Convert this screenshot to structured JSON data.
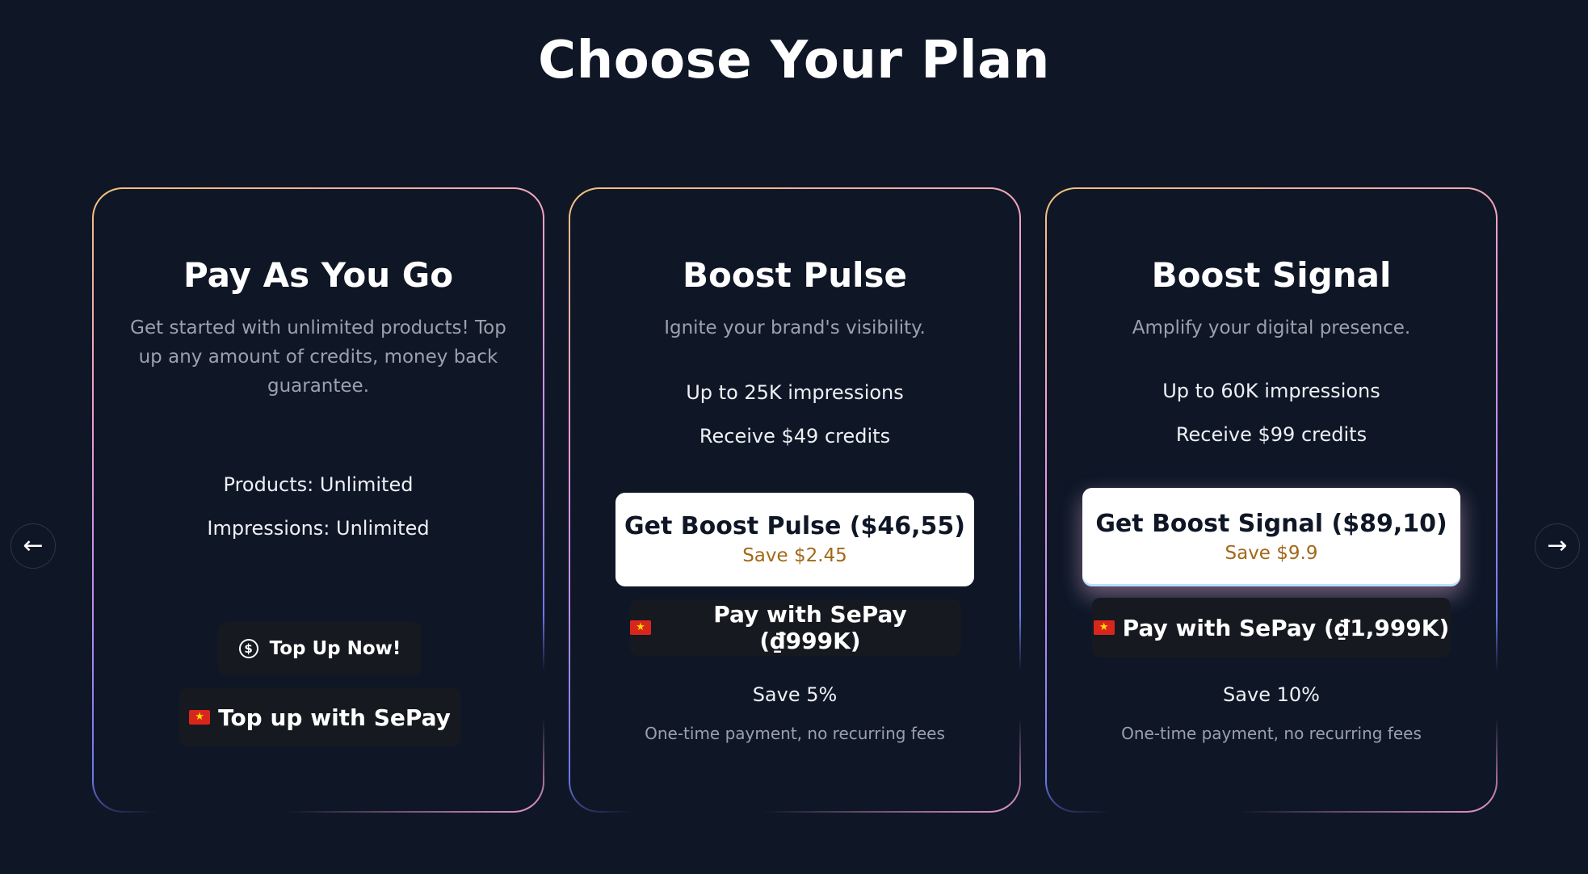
{
  "page": {
    "title": "Choose Your Plan"
  },
  "navigation": {
    "prev_icon": "arrow-left-icon",
    "next_icon": "arrow-right-icon",
    "prev_glyph": "←",
    "next_glyph": "→"
  },
  "plans": [
    {
      "title": "Pay As You Go",
      "description": "Get started with unlimited products! Top up any amount of credits, money back guarantee.",
      "features": [
        "Products: Unlimited",
        "Impressions: Unlimited"
      ],
      "topup_label": "Top Up Now!",
      "topup_icon": "dollar-circle-icon",
      "sepay_label": "Top up with SePay"
    },
    {
      "title": "Boost Pulse",
      "description": "Ignite your brand's visibility.",
      "features": [
        "Up to 25K impressions",
        "Receive $49 credits"
      ],
      "button_label": "Get Boost Pulse ($46,55)",
      "button_save": "Save $2.45",
      "sepay_label": "Pay with SePay (₫999K)",
      "save_percent": "Save 5%",
      "payment_note": "One-time payment, no recurring fees"
    },
    {
      "title": "Boost Signal",
      "description": "Amplify your digital presence.",
      "features": [
        "Up to 60K impressions",
        "Receive $99 credits"
      ],
      "button_label": "Get Boost Signal ($89,10)",
      "button_save": "Save $9.9",
      "sepay_label": "Pay with SePay (₫1,999K)",
      "save_percent": "Save 10%",
      "payment_note": "One-time payment, no recurring fees"
    }
  ],
  "flag": {
    "icon": "vietnam-flag-icon",
    "glyph": "★"
  },
  "colors": {
    "background": "#0f1727",
    "card_border_gradient": [
      "#f4c27a",
      "#f29bd2",
      "#b68cf2",
      "#6e77ea"
    ],
    "save_text": "#a3681a",
    "button_background": "#ffffff",
    "secondary_button": "#16191f"
  }
}
